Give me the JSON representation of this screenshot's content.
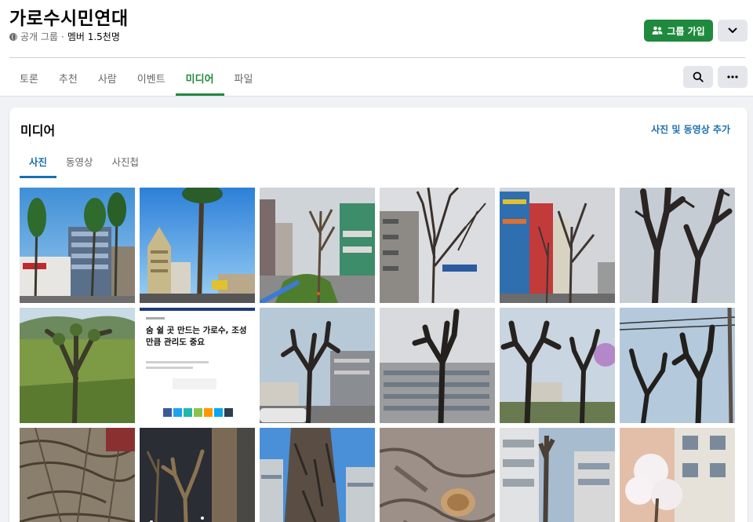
{
  "group": {
    "title": "가로수시민연대",
    "privacy": "공개 그룹",
    "separator": "·",
    "members": "멤버 1.5천명"
  },
  "actions": {
    "join_label": "그룹 가입"
  },
  "nav": {
    "tabs": [
      {
        "label": "토론"
      },
      {
        "label": "추천"
      },
      {
        "label": "사람"
      },
      {
        "label": "이벤트"
      },
      {
        "label": "미디어"
      },
      {
        "label": "파일"
      }
    ],
    "active": "미디어"
  },
  "media": {
    "title": "미디어",
    "add_label": "사진 및 동영상 추가",
    "subtabs": [
      {
        "label": "사진"
      },
      {
        "label": "동영상"
      },
      {
        "label": "사진첩"
      }
    ],
    "active_subtab": "사진",
    "news_headline": "숨 쉴 곳 만드는 가로수, 조성만큼 관리도 중요"
  },
  "colors": {
    "accent_green": "#1f8a3e",
    "link_blue": "#1a6faf",
    "page_bg": "#f0f2f5"
  },
  "icons": {
    "privacy": "globe-icon",
    "join": "group-people-icon",
    "dropdown": "chevron-down-icon",
    "search": "search-icon",
    "more": "more-dots-icon"
  }
}
